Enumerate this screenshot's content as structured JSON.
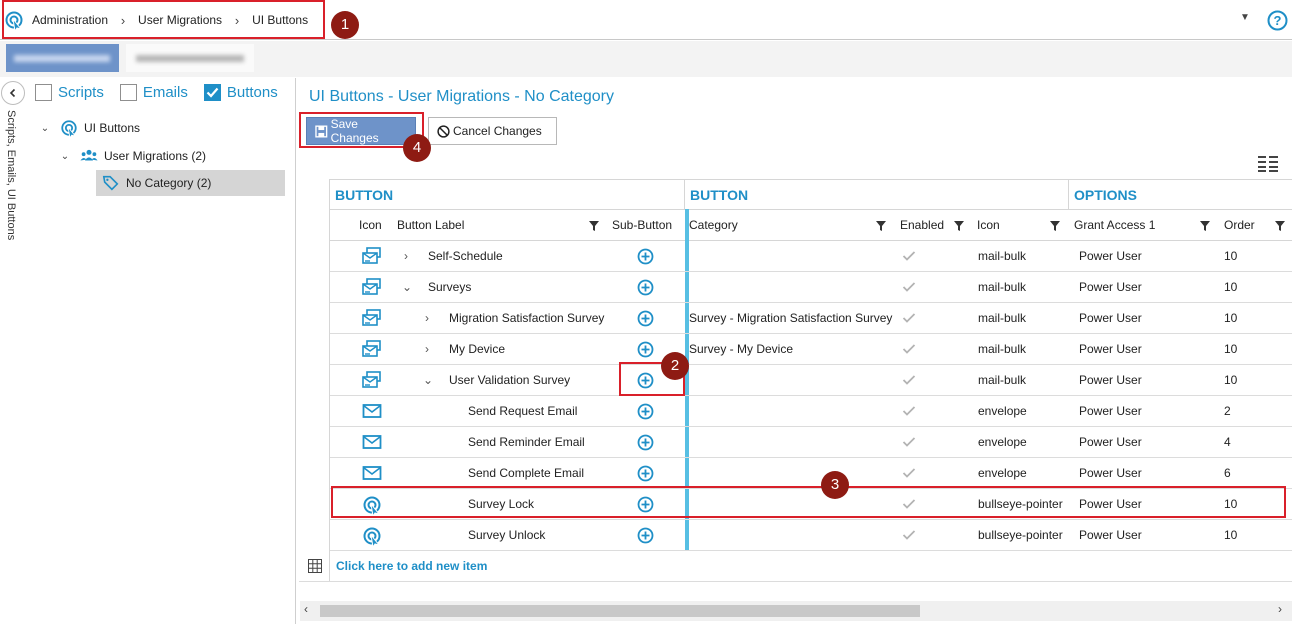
{
  "breadcrumb": [
    "Administration",
    "User Migrations",
    "UI Buttons"
  ],
  "left_panel": {
    "vertical_label": "Scripts, Emails, UI Buttons",
    "filters": [
      {
        "label": "Scripts",
        "checked": false
      },
      {
        "label": "Emails",
        "checked": false
      },
      {
        "label": "Buttons",
        "checked": true
      }
    ],
    "tree": [
      {
        "label": "UI Buttons",
        "icon": "bullseye-pointer-icon"
      },
      {
        "label": "User Migrations  (2)",
        "icon": "users-icon"
      },
      {
        "label": "No Category  (2)",
        "icon": "tags-icon",
        "selected": true
      }
    ]
  },
  "main": {
    "title": "UI Buttons - User Migrations - No Category",
    "save_label": "Save Changes",
    "cancel_label": "Cancel Changes",
    "groups": [
      "BUTTON",
      "BUTTON",
      "OPTIONS"
    ],
    "columns": [
      "Icon",
      "Button Label",
      "Sub-Button",
      "Category",
      "Enabled",
      "Icon",
      "Grant Access 1",
      "Order"
    ],
    "rows": [
      {
        "icon": "mail-bulk",
        "caret": ">",
        "label": "Self-Schedule",
        "category": "",
        "icon_name": "mail-bulk",
        "access": "Power User",
        "order": "10"
      },
      {
        "icon": "mail-bulk",
        "caret": "v",
        "label": "Surveys",
        "category": "",
        "icon_name": "mail-bulk",
        "access": "Power User",
        "order": "10"
      },
      {
        "icon": "mail-bulk",
        "caret": ">",
        "label": "Migration Satisfaction Survey",
        "category": "Survey - Migration Satisfaction Survey",
        "icon_name": "mail-bulk",
        "access": "Power User",
        "order": "10"
      },
      {
        "icon": "mail-bulk",
        "caret": ">",
        "label": "My Device",
        "category": "Survey - My Device",
        "icon_name": "mail-bulk",
        "access": "Power User",
        "order": "10"
      },
      {
        "icon": "mail-bulk",
        "caret": "v",
        "label": "User Validation Survey",
        "category": "",
        "icon_name": "mail-bulk",
        "access": "Power User",
        "order": "10"
      },
      {
        "icon": "envelope",
        "caret": "",
        "label": "Send Request Email",
        "category": "",
        "icon_name": "envelope",
        "access": "Power User",
        "order": "2"
      },
      {
        "icon": "envelope",
        "caret": "",
        "label": "Send Reminder Email",
        "category": "",
        "icon_name": "envelope",
        "access": "Power User",
        "order": "4"
      },
      {
        "icon": "envelope",
        "caret": "",
        "label": "Send Complete Email",
        "category": "",
        "icon_name": "envelope",
        "access": "Power User",
        "order": "6"
      },
      {
        "icon": "bullseye-pointer",
        "caret": "",
        "label": "Survey Lock",
        "category": "",
        "icon_name": "bullseye-pointer",
        "access": "Power User",
        "order": "10"
      },
      {
        "icon": "bullseye-pointer",
        "caret": "",
        "label": "Survey Unlock",
        "category": "",
        "icon_name": "bullseye-pointer",
        "access": "Power User",
        "order": "10"
      }
    ],
    "add_item_label": "Click here to add new item"
  },
  "annotations": [
    "1",
    "2",
    "3",
    "4"
  ],
  "colors": {
    "accent": "#1f8fc7",
    "save_button": "#6e93c9",
    "annotation": "#d9202a",
    "badge": "#8e1b13",
    "splitter": "#57bfe3"
  }
}
